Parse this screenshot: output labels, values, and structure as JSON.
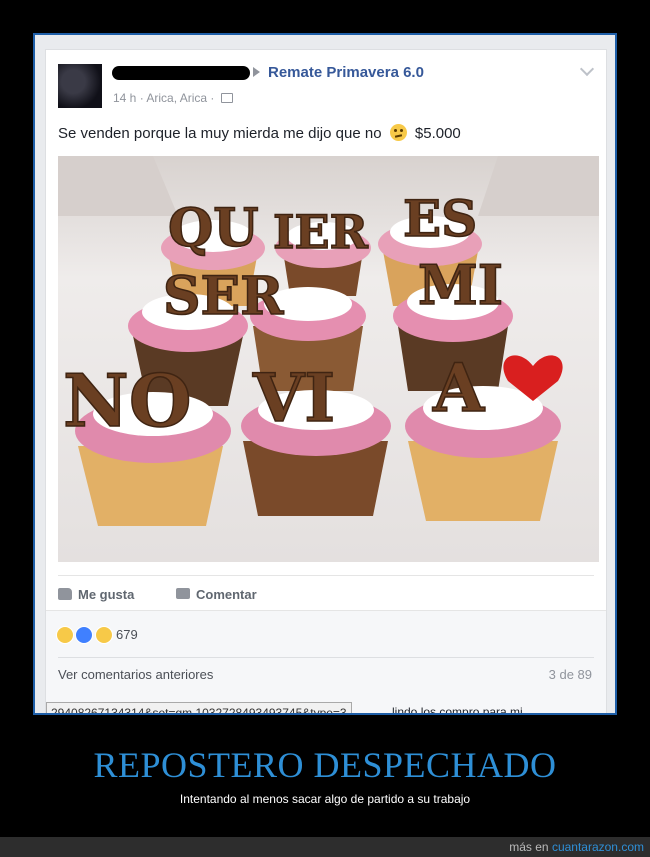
{
  "post": {
    "group_name": "Remate Primavera 6.0",
    "time": "14 h",
    "location": "Arica, Arica",
    "text": "Se venden porque la muy mierda me dijo que no",
    "price": "$5.000",
    "photo_letters": [
      "QU",
      "IER",
      "ES",
      "SER",
      "MI",
      "NO",
      "VI",
      "A"
    ]
  },
  "actions": {
    "like_label": "Me gusta",
    "comment_label": "Comentar"
  },
  "reactions": {
    "count": "679",
    "previous_comments": "Ver comentarios anteriores",
    "comment_position": "3 de 89"
  },
  "status_bar": {
    "url": "29408267134314&set=gm.1032728493493745&type=3",
    "comment_snippet": "lindo los compro para mi"
  },
  "meme": {
    "title": "REPOSTERO DESPECHADO",
    "caption": "Intentando al menos sacar algo de partido a su trabajo"
  },
  "footer": {
    "prefix": "más en",
    "site": "cuantarazon.com"
  }
}
